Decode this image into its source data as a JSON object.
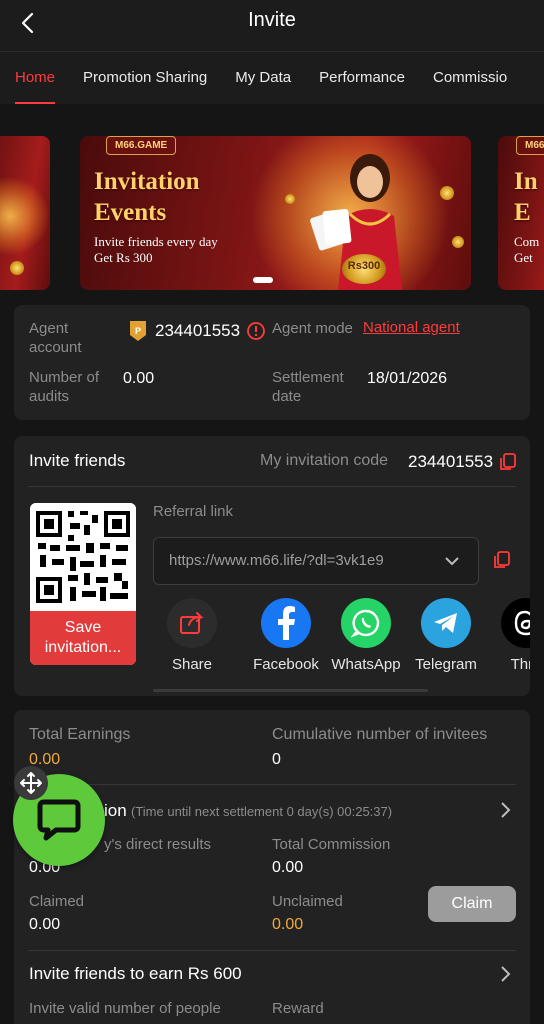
{
  "header": {
    "title": "Invite"
  },
  "tabs": [
    {
      "label": "Home",
      "active": true
    },
    {
      "label": "Promotion Sharing"
    },
    {
      "label": "My Data"
    },
    {
      "label": "Performance"
    },
    {
      "label": "Commissio"
    }
  ],
  "banner": {
    "logo": "M66.GAME",
    "title_line1": "Invitation",
    "title_line2": "Events",
    "sub_line1": "Invite friends every day",
    "sub_line2": "Get Rs 300",
    "chip_text": "Rs300",
    "peek_right_title1": "In",
    "peek_right_title2": "E",
    "peek_right_sub1": "Com",
    "peek_right_sub2": "Get"
  },
  "agent": {
    "account_label": "Agent account",
    "account_value": "234401553",
    "mode_label": "Agent mode",
    "mode_value": "National agent",
    "audits_label": "Number of audits",
    "audits_value": "0.00",
    "settlement_label": "Settlement date",
    "settlement_value": "18/01/2026"
  },
  "invite": {
    "title": "Invite friends",
    "code_label": "My invitation code",
    "code_value": "234401553",
    "save_label": "Save invitation...",
    "referral_label": "Referral link",
    "referral_value": "https://www.m66.life/?dl=3vk1e9",
    "share_items": [
      {
        "label": "Share",
        "icon": "share-icon"
      },
      {
        "label": "Facebook",
        "icon": "facebook-icon"
      },
      {
        "label": "WhatsApp",
        "icon": "whatsapp-icon"
      },
      {
        "label": "Telegram",
        "icon": "telegram-icon"
      },
      {
        "label": "Thre",
        "icon": "threads-icon"
      }
    ]
  },
  "earnings": {
    "total_label": "Total Earnings",
    "total_value": "0.00",
    "cumulative_label": "Cumulative number of invitees",
    "cumulative_value": "0",
    "commission_title": "ion",
    "commission_note": "(Time until next settlement 0 day(s) 00:25:37)",
    "direct_label": "y's direct results",
    "direct_value": "0.00",
    "total_commission_label": "Total Commission",
    "total_commission_value": "0.00",
    "claimed_label": "Claimed",
    "claimed_value": "0.00",
    "unclaimed_label": "Unclaimed",
    "unclaimed_value": "0.00",
    "claim_button": "Claim",
    "earn_title": "Invite friends to earn Rs 600",
    "valid_label": "Invite valid number of people",
    "reward_label": "Reward"
  },
  "colors": {
    "accent": "#ff3b3b",
    "gold": "#f2a93b",
    "chat_green": "#5ec93b",
    "facebook": "#1877f2",
    "whatsapp": "#25d366",
    "telegram": "#2aa3df"
  }
}
